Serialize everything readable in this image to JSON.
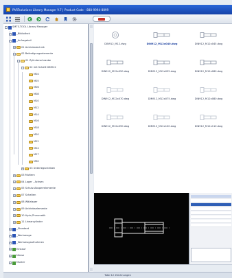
{
  "window": {
    "title": "PARTsolutions Library Manager V.7 | Product Code - 888-9994-8899"
  },
  "toolbar": {
    "icons": [
      "grid-icon",
      "list-icon",
      "back-icon",
      "forward-icon",
      "refresh-icon",
      "home-icon",
      "bookmark-icon",
      "settings-icon"
    ]
  },
  "tree": {
    "items": [
      {
        "label": "SMTS-TOOL Library Manager",
        "depth": 0,
        "kind": "root"
      },
      {
        "label": "_Bibliothek",
        "depth": 1,
        "kind": "tag"
      },
      {
        "label": "_Anfrageteil",
        "depth": 1,
        "kind": "tag"
      },
      {
        "label": "01 Antriebstechnik",
        "depth": 2,
        "kind": "folder"
      },
      {
        "label": "02 Befestigungselemente",
        "depth": 2,
        "kind": "folder-open"
      },
      {
        "label": "01 Zylinderschraube",
        "depth": 3,
        "kind": "folder-open"
      },
      {
        "label": "02 mit Schaft DIN912",
        "depth": 4,
        "kind": "folder-open"
      },
      {
        "label": "M04",
        "depth": 5,
        "kind": "folder"
      },
      {
        "label": "M05",
        "depth": 5,
        "kind": "folder"
      },
      {
        "label": "M06",
        "depth": 5,
        "kind": "folder"
      },
      {
        "label": "M08",
        "depth": 5,
        "kind": "folder"
      },
      {
        "label": "M10",
        "depth": 5,
        "kind": "folder"
      },
      {
        "label": "M12",
        "depth": 5,
        "kind": "folder"
      },
      {
        "label": "M14",
        "depth": 5,
        "kind": "folder"
      },
      {
        "label": "M16",
        "depth": 5,
        "kind": "folder"
      },
      {
        "label": "M18",
        "depth": 5,
        "kind": "folder"
      },
      {
        "label": "M20",
        "depth": 5,
        "kind": "folder"
      },
      {
        "label": "M22",
        "depth": 5,
        "kind": "folder"
      },
      {
        "label": "M24",
        "depth": 5,
        "kind": "folder"
      },
      {
        "label": "M27",
        "depth": 5,
        "kind": "folder"
      },
      {
        "label": "M30",
        "depth": 5,
        "kind": "folder"
      },
      {
        "label": "03 Unterlegscheiben",
        "depth": 4,
        "kind": "folder"
      },
      {
        "label": "03 Muttern",
        "depth": 2,
        "kind": "folder"
      },
      {
        "label": "04 Lager - Achsen",
        "depth": 2,
        "kind": "folder"
      },
      {
        "label": "05 Schutz-Absperrelemente",
        "depth": 2,
        "kind": "folder"
      },
      {
        "label": "07 Schalten",
        "depth": 2,
        "kind": "folder"
      },
      {
        "label": "08 Wälzlager",
        "depth": 2,
        "kind": "folder"
      },
      {
        "label": "09 Antriebselemente",
        "depth": 2,
        "kind": "folder"
      },
      {
        "label": "10 Hydr./Pneumatik",
        "depth": 2,
        "kind": "folder"
      },
      {
        "label": "11 Linearzylinder",
        "depth": 2,
        "kind": "folder"
      },
      {
        "label": "_Standard",
        "depth": 1,
        "kind": "tag"
      },
      {
        "label": "_Werkzeuge",
        "depth": 1,
        "kind": "tag"
      },
      {
        "label": "_Werkzeugaufnahmen",
        "depth": 1,
        "kind": "tag"
      },
      {
        "label": "Einkauf",
        "depth": 1,
        "kind": "tag-green"
      },
      {
        "label": "Messe",
        "depth": 1,
        "kind": "tag-green"
      },
      {
        "label": "Muster",
        "depth": 1,
        "kind": "tag-green"
      }
    ]
  },
  "parts": [
    {
      "caption": "DIN912_M12.dwg",
      "shape": "circle",
      "selected": false
    },
    {
      "caption": "DIN912_M12x040.dwg",
      "shape": "bolt",
      "selected": true
    },
    {
      "caption": "DIN912_M12x045.dwg",
      "shape": "bolt",
      "selected": false
    },
    {
      "caption": "DIN912_M12x050.dwg",
      "shape": "bolt",
      "selected": false
    },
    {
      "caption": "DIN912_M12x055.dwg",
      "shape": "bolt",
      "selected": false
    },
    {
      "caption": "DIN912_M12x060.dwg",
      "shape": "bolt",
      "selected": false
    },
    {
      "caption": "DIN912_M12x070.dwg",
      "shape": "bolt-faint",
      "selected": false
    },
    {
      "caption": "DIN912_M12x075.dwg",
      "shape": "bolt-faint",
      "selected": false
    },
    {
      "caption": "DIN912_M12x080.dwg",
      "shape": "bolt-faint",
      "selected": false
    },
    {
      "caption": "DIN912_M12x090.dwg",
      "shape": "bolt-faint",
      "selected": false
    },
    {
      "caption": "DIN912_M12x100.dwg",
      "shape": "bolt-faint",
      "selected": false
    },
    {
      "caption": "DIN912_M12x110.dwg",
      "shape": "bolt-faint",
      "selected": false
    }
  ],
  "preview": {
    "label": "preview"
  },
  "status": {
    "text": "Total 12 Zeichnungen"
  },
  "colors": {
    "titlebar": "#1f4fc0",
    "selection": "#2f5fb6",
    "preview_bg": "#050505",
    "preview_line": "#e8e8e8"
  }
}
